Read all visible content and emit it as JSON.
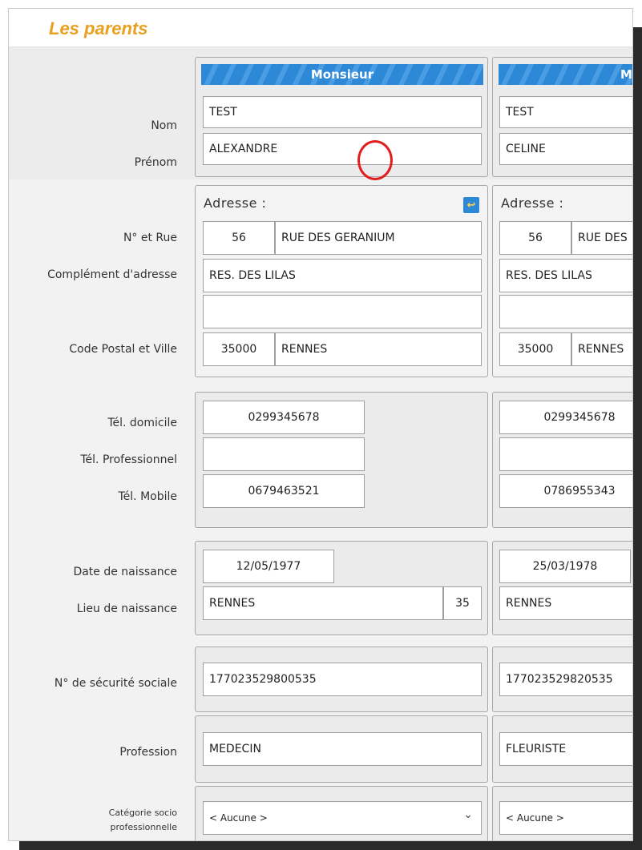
{
  "title": "Les parents",
  "columns": {
    "father_header": "Monsieur",
    "mother_header": "Mac"
  },
  "labels": {
    "nom": "Nom",
    "prenom": "Prénom",
    "adresse": "Adresse :",
    "rue": "N° et Rue",
    "complement": "Complément d'adresse",
    "cp_ville": "Code Postal et Ville",
    "tel_domicile": "Tél. domicile",
    "tel_pro": "Tél. Professionnel",
    "tel_mobile": "Tél. Mobile",
    "date_naissance": "Date de naissance",
    "lieu_naissance": "Lieu de naissance",
    "secu": "N° de sécurité sociale",
    "profession": "Profession",
    "csp_line1": "Catégorie socio",
    "csp_line2": "professionnelle"
  },
  "father": {
    "nom": "TEST",
    "prenom": "ALEXANDRE",
    "numero": "56",
    "rue": "RUE DES GERANIUM",
    "complement1": "RES. DES LILAS",
    "complement2": "",
    "cp": "35000",
    "ville": "RENNES",
    "tel_domicile": "0299345678",
    "tel_pro": "",
    "tel_mobile": "0679463521",
    "date_naissance": "12/05/1977",
    "lieu_naissance": "RENNES",
    "dept_naissance": "35",
    "secu": "177023529800535",
    "profession": "MEDECIN",
    "csp": "< Aucune >"
  },
  "mother": {
    "nom": "TEST",
    "prenom": "CELINE",
    "numero": "56",
    "rue": "RUE DES",
    "complement1": "RES. DES LILAS",
    "complement2": "",
    "cp": "35000",
    "ville": "RENNES",
    "tel_domicile": "0299345678",
    "tel_pro": "",
    "tel_mobile": "0786955343",
    "date_naissance": "25/03/1978",
    "lieu_naissance": "RENNES",
    "secu": "177023529820535",
    "profession": "FLEURISTE",
    "csp": "< Aucune >"
  },
  "icons": {
    "copy_address": "copy-address-icon",
    "dropdown": "chevron-down-icon"
  },
  "colors": {
    "title": "#e8a01f",
    "header": "#2e88d8",
    "annotation_circle": "#e21e1e"
  }
}
